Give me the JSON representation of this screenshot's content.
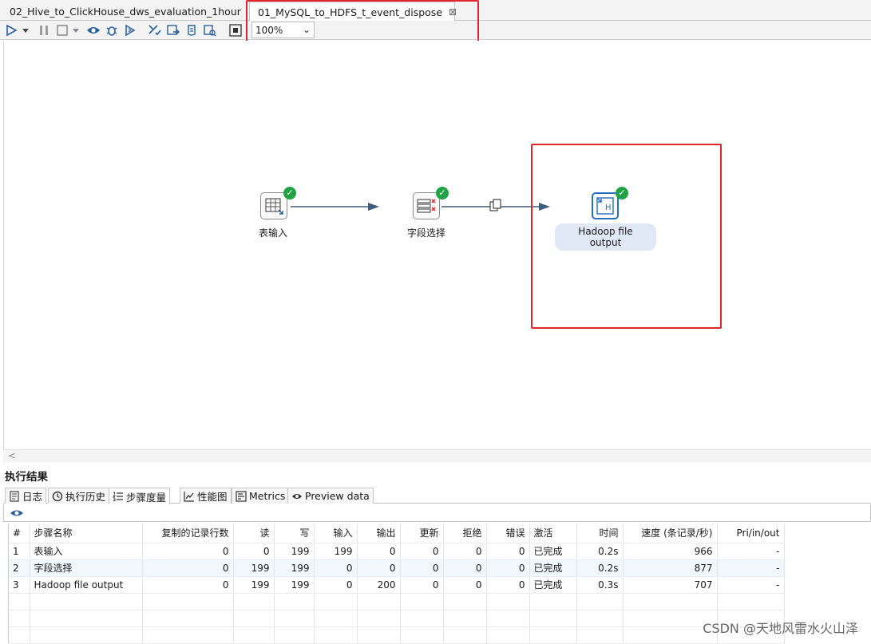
{
  "tabs": [
    {
      "label": "02_Hive_to_ClickHouse_dws_evaluation_1hour",
      "active": false
    },
    {
      "label": "01_MySQL_to_HDFS_t_event_dispose",
      "active": true
    }
  ],
  "toolbar": {
    "zoom": "100%"
  },
  "canvas": {
    "steps": [
      {
        "label": "表输入",
        "status": "success"
      },
      {
        "label": "字段选择",
        "status": "success"
      },
      {
        "label": "Hadoop file output",
        "status": "success"
      }
    ]
  },
  "results": {
    "title": "执行结果",
    "tabs": [
      "日志",
      "执行历史",
      "步骤度量",
      "性能图",
      "Metrics",
      "Preview data"
    ],
    "active_tab": "步骤度量",
    "columns": [
      "#",
      "步骤名称",
      "复制的记录行数",
      "读",
      "写",
      "输入",
      "输出",
      "更新",
      "拒绝",
      "错误",
      "激活",
      "时间",
      "速度 (条记录/秒)",
      "Pri/in/out"
    ],
    "rows": [
      [
        "1",
        "表输入",
        "0",
        "0",
        "199",
        "199",
        "0",
        "0",
        "0",
        "0",
        "已完成",
        "0.2s",
        "966",
        "-"
      ],
      [
        "2",
        "字段选择",
        "0",
        "199",
        "199",
        "0",
        "0",
        "0",
        "0",
        "0",
        "已完成",
        "0.2s",
        "877",
        "-"
      ],
      [
        "3",
        "Hadoop file output",
        "0",
        "199",
        "199",
        "0",
        "200",
        "0",
        "0",
        "0",
        "已完成",
        "0.3s",
        "707",
        "-"
      ]
    ]
  },
  "watermark": "CSDN @天地风雷水火山泽",
  "colors": {
    "accent": "#2a6fbf",
    "success": "#21a345",
    "highlight": "#e0262a"
  }
}
